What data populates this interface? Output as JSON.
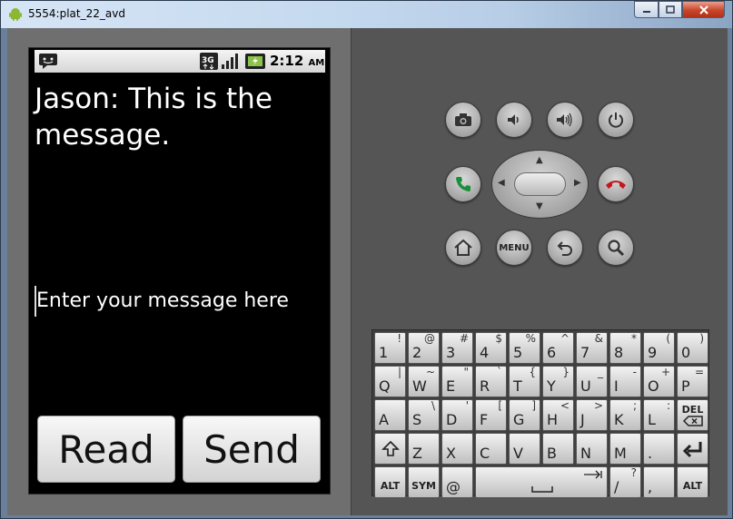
{
  "window": {
    "title": "5554:plat_22_avd",
    "controls": {
      "minimize_icon": "minimize-icon",
      "maximize_icon": "maximize-icon",
      "close_icon": "close-icon"
    }
  },
  "status_bar": {
    "notification_icon": "sms-notification-icon",
    "network_label": "3G",
    "signal_icon": "signal-icon",
    "battery_icon": "battery-charging-icon",
    "time": "2:12",
    "ampm": "AM"
  },
  "app": {
    "message": "Jason: This is the message.",
    "input_placeholder": "Enter your message here",
    "read_label": "Read",
    "send_label": "Send"
  },
  "hardware": {
    "menu_label": "MENU",
    "icons": [
      "camera-icon",
      "volume-down-icon",
      "volume-up-icon",
      "power-icon",
      "call-icon",
      "end-call-icon",
      "home-icon",
      "back-icon",
      "search-icon"
    ],
    "accent_colors": {
      "call": "#1a8f3a",
      "end_call": "#c4171d"
    }
  },
  "keyboard": {
    "rows": [
      [
        {
          "main": "1",
          "alt": "!"
        },
        {
          "main": "2",
          "alt": "@"
        },
        {
          "main": "3",
          "alt": "#"
        },
        {
          "main": "4",
          "alt": "$"
        },
        {
          "main": "5",
          "alt": "%"
        },
        {
          "main": "6",
          "alt": "^"
        },
        {
          "main": "7",
          "alt": "&"
        },
        {
          "main": "8",
          "alt": "*"
        },
        {
          "main": "9",
          "alt": "("
        },
        {
          "main": "0",
          "alt": ")"
        }
      ],
      [
        {
          "main": "Q",
          "alt": "|"
        },
        {
          "main": "W",
          "alt": "~"
        },
        {
          "main": "E",
          "alt": "\""
        },
        {
          "main": "R",
          "alt": "`"
        },
        {
          "main": "T",
          "alt": "{"
        },
        {
          "main": "Y",
          "alt": "}"
        },
        {
          "main": "U",
          "alt": "_"
        },
        {
          "main": "I",
          "alt": "-"
        },
        {
          "main": "O",
          "alt": "+"
        },
        {
          "main": "P",
          "alt": "="
        }
      ],
      [
        {
          "main": "A",
          "alt": ""
        },
        {
          "main": "S",
          "alt": "\\"
        },
        {
          "main": "D",
          "alt": "'"
        },
        {
          "main": "F",
          "alt": "["
        },
        {
          "main": "G",
          "alt": "]"
        },
        {
          "main": "H",
          "alt": "<"
        },
        {
          "main": "J",
          "alt": ">"
        },
        {
          "main": "K",
          "alt": ";"
        },
        {
          "main": "L",
          "alt": ":"
        },
        {
          "main": "DEL",
          "alt": ""
        }
      ],
      [
        {
          "main": "",
          "alt": ""
        },
        {
          "main": "Z",
          "alt": ""
        },
        {
          "main": "X",
          "alt": ""
        },
        {
          "main": "C",
          "alt": ""
        },
        {
          "main": "V",
          "alt": ""
        },
        {
          "main": "B",
          "alt": ""
        },
        {
          "main": "N",
          "alt": ""
        },
        {
          "main": "M",
          "alt": ""
        },
        {
          "main": ".",
          "alt": ""
        },
        {
          "main": "",
          "alt": ""
        }
      ],
      [
        {
          "main": "ALT",
          "alt": ""
        },
        {
          "main": "SYM",
          "alt": ""
        },
        {
          "main": "@",
          "alt": ""
        },
        {
          "main": "",
          "alt": ""
        },
        {
          "main": "/",
          "alt": "?"
        },
        {
          "main": ",",
          "alt": ""
        },
        {
          "main": "ALT",
          "alt": ""
        }
      ]
    ],
    "icon_keys": {
      "shift": "shift-arrow-icon",
      "enter": "enter-arrow-icon",
      "delete": "delete-backspace-icon",
      "space": "space-bar-icon",
      "tab": "tab-arrow-icon"
    }
  }
}
